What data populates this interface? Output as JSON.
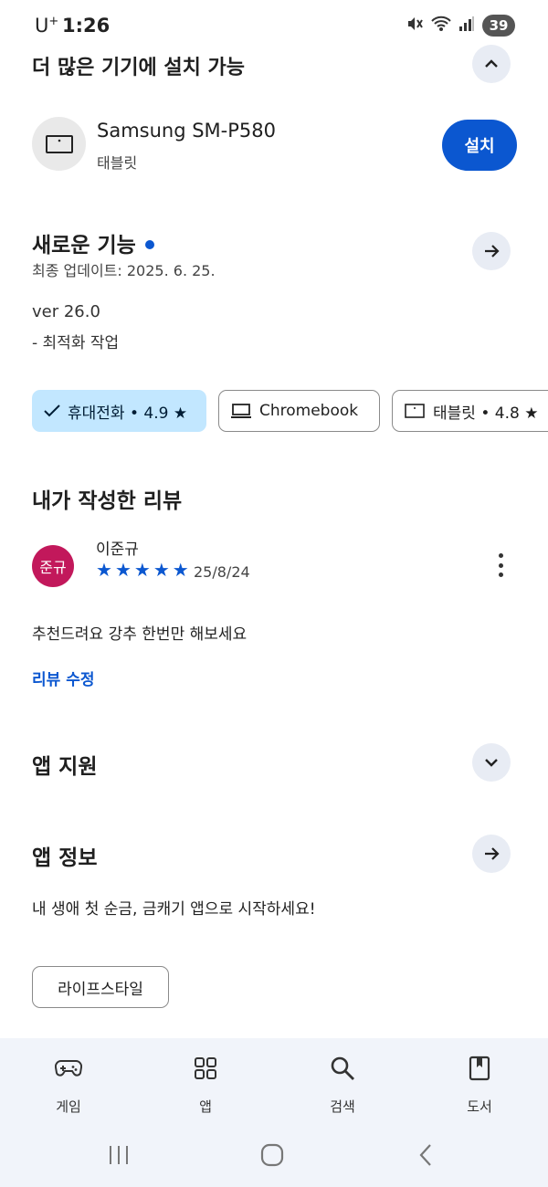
{
  "status_bar": {
    "carrier": "U",
    "carrier_sup": "+",
    "time": "1:26",
    "battery": "39"
  },
  "more_devices": {
    "title": "더 많은 기기에 설치 가능",
    "device_name": "Samsung SM-P580",
    "device_type": "태블릿",
    "install_label": "설치"
  },
  "whats_new": {
    "title": "새로운 기능",
    "updated": "최종 업데이트: 2025. 6. 25.",
    "version": "ver 26.0",
    "notes": "- 최적화 작업"
  },
  "device_chips": [
    {
      "label": "휴대전화 • 4.9 ★",
      "selected": true
    },
    {
      "label": "Chromebook",
      "selected": false
    },
    {
      "label": "태블릿 • 4.8 ★",
      "selected": false
    }
  ],
  "my_review": {
    "title": "내가 작성한 리뷰",
    "avatar_text": "준규",
    "reviewer": "이준규",
    "rating": 5,
    "date": "25/8/24",
    "text": "추천드려요 강추 한번만 해보세요",
    "edit_label": "리뷰 수정"
  },
  "app_support": {
    "title": "앱 지원"
  },
  "app_info": {
    "title": "앱 정보",
    "description": "내 생애 첫 순금, 금캐기 앱으로 시작하세요!",
    "category": "라이프스타일"
  },
  "bottom_nav": [
    {
      "label": "게임",
      "icon": "gamepad-icon"
    },
    {
      "label": "앱",
      "icon": "apps-grid-icon"
    },
    {
      "label": "검색",
      "icon": "search-icon"
    },
    {
      "label": "도서",
      "icon": "book-icon"
    }
  ],
  "colors": {
    "accent": "#0b57d0",
    "chip_selected": "#c2e7ff",
    "avatar": "#c2185b",
    "nav_bg": "#f1f4fa"
  }
}
